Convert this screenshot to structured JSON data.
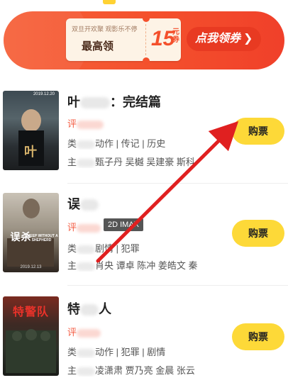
{
  "banner": {
    "subtitle": "双旦开欢聚 观影乐不停",
    "main_label": "最高领",
    "amount": "15",
    "unit": "元券",
    "cta_label": "点我领券",
    "cta_icon": "chevron-right-icon",
    "colors": {
      "background": "#f4502c",
      "ticket": "#fdf3e6",
      "cta": "#e83a22"
    }
  },
  "movies": [
    {
      "title": "叶",
      "title_suffix": "：完结篇",
      "score_prefix": "评",
      "genre_prefix": "类",
      "genres": "动作 | 传记 | 历史",
      "cast_prefix": "主",
      "cast": "甄子丹 吴樾 吴建豪 斯科",
      "poster_title": "叶",
      "poster_date": "2019.12.20",
      "buy_label": "购票"
    },
    {
      "title": "误",
      "title_suffix": "",
      "score_prefix": "评",
      "tag": "2D IMAX",
      "genre_prefix": "类",
      "genres": "剧情 | 犯罪",
      "cast_prefix": "主",
      "cast": "肖央 谭卓 陈冲 姜皓文 秦",
      "poster_title": "误杀",
      "poster_subtitle": "SHEEP WITHOUT A SHEPHERD",
      "poster_date": "2019.12.13",
      "buy_label": "购票"
    },
    {
      "title": "特",
      "title_suffix": "人",
      "score_prefix": "评",
      "genre_prefix": "类",
      "genres": "动作 | 犯罪 | 剧情",
      "cast_prefix": "主",
      "cast": "凌潇肃 贾乃亮 金晨 张云",
      "poster_title": "特警队",
      "buy_label": "购票"
    }
  ],
  "accent_color": "#fdd938",
  "annotation_color": "#e02020"
}
